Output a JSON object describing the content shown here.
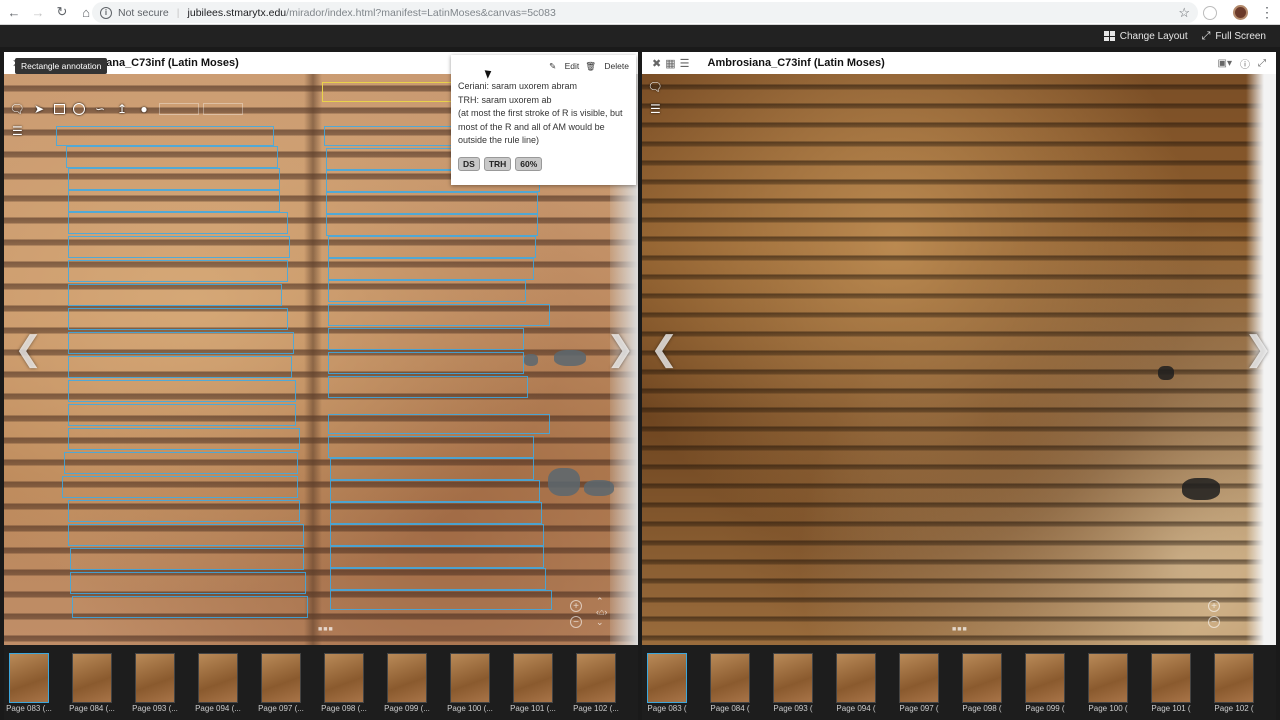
{
  "browser": {
    "security": "Not secure",
    "separator": "|",
    "url_host": "jubilees.stmarytx.edu",
    "url_path": "/mirador/index.html?manifest=LatinMoses&canvas=5c083"
  },
  "mirador": {
    "change_layout": "Change Layout",
    "full_screen": "Full Screen"
  },
  "left_panel": {
    "title": "Ambrosiana_C73inf (Latin Moses)",
    "title_visible": "brosiana_C73inf (Latin Moses)",
    "tooltip": "Rectangle annotation"
  },
  "annotation": {
    "edit": "Edit",
    "delete": "Delete",
    "lines": [
      "Ceriani: saram uxorem abram",
      "TRH: saram uxorem ab",
      "(at most the first stroke of R is visible, but",
      "most of the R and all of AM would be",
      "outside the rule line)"
    ],
    "tags": [
      "DS",
      "TRH",
      "60%"
    ]
  },
  "right_panel": {
    "title": "Ambrosiana_C73inf (Latin Moses)"
  },
  "thumbnails_left": [
    "Page 083 (...",
    "Page 084 (...",
    "Page 093 (...",
    "Page 094 (...",
    "Page 097 (...",
    "Page 098 (...",
    "Page 099 (...",
    "Page 100 (...",
    "Page 101 (...",
    "Page 102 (..."
  ],
  "thumbnails_right": [
    "Page 083 (",
    "Page 084 (",
    "Page 093 (",
    "Page 094 (",
    "Page 097 (",
    "Page 098 (",
    "Page 099 (",
    "Page 100 (",
    "Page 101 (",
    "Page 102 ("
  ],
  "colors": {
    "annotation_box": "#3caae6",
    "selected_box": "#e9d34a",
    "active_thumb": "#3ca7dd"
  }
}
